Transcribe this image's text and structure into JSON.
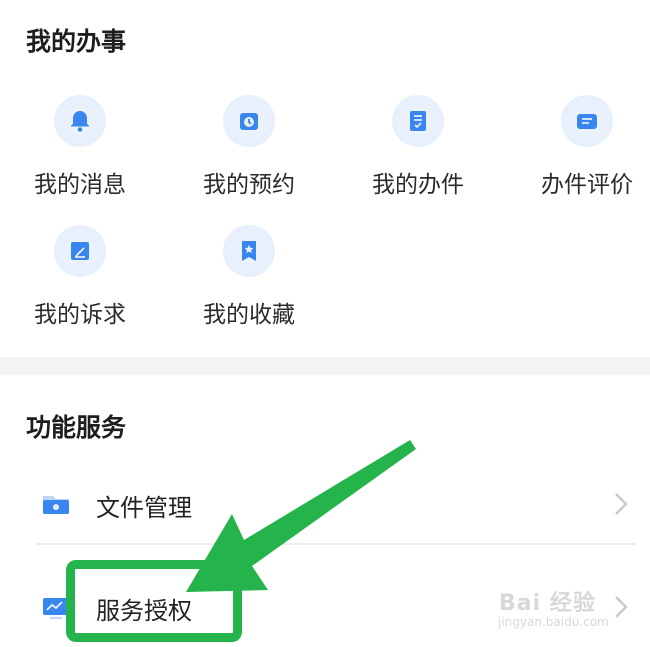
{
  "sections": {
    "my_tasks_title": "我的办事",
    "services_title": "功能服务"
  },
  "grid": [
    {
      "label": "我的消息",
      "icon": "bell-icon"
    },
    {
      "label": "我的预约",
      "icon": "calendar-clock-icon"
    },
    {
      "label": "我的办件",
      "icon": "document-icon"
    },
    {
      "label": "办件评价",
      "icon": "comment-icon"
    },
    {
      "label": "我的诉求",
      "icon": "edit-note-icon"
    },
    {
      "label": "我的收藏",
      "icon": "bookmark-star-icon"
    }
  ],
  "service_rows": [
    {
      "label": "文件管理",
      "icon": "folder-icon"
    },
    {
      "label": "服务授权",
      "icon": "monitor-icon"
    }
  ],
  "watermark": {
    "main": "Bai 经验",
    "sub": "jingyan.baidu.com"
  },
  "colors": {
    "icon_blue": "#3a86f0",
    "highlight_green": "#25b34b"
  }
}
